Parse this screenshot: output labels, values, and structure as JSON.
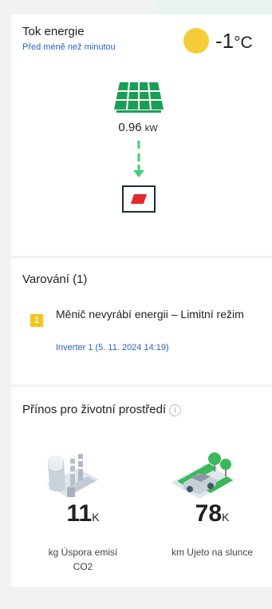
{
  "energy_flow": {
    "title": "Tok energie",
    "updated": "Před méně než minutou",
    "temperature_value": "-1",
    "temperature_unit": "°C",
    "solar_power_value": "0.96",
    "solar_power_unit": "kW",
    "weather_icon": "sun-icon",
    "colors": {
      "panel": "#1a9e55",
      "arrow": "#3ecf78",
      "inverter_accent": "#e5262c",
      "sun": "#f5cc38"
    }
  },
  "warnings": {
    "title": "Varování (1)",
    "items": [
      {
        "level": "1",
        "message": "Měnič nevyrábí energii – Limitní režim",
        "source": "Inverter 1 (5. 11. 2024 14:19)"
      }
    ]
  },
  "environment": {
    "title": "Přínos pro životní prostředí",
    "info_icon": "i",
    "metrics": [
      {
        "value": "11",
        "suffix": "K",
        "label": "kg Úspora emisí CO2",
        "icon": "co2-plant-icon"
      },
      {
        "value": "78",
        "suffix": "K",
        "label": "km Ujeto na slunce",
        "icon": "electric-car-icon"
      }
    ]
  }
}
